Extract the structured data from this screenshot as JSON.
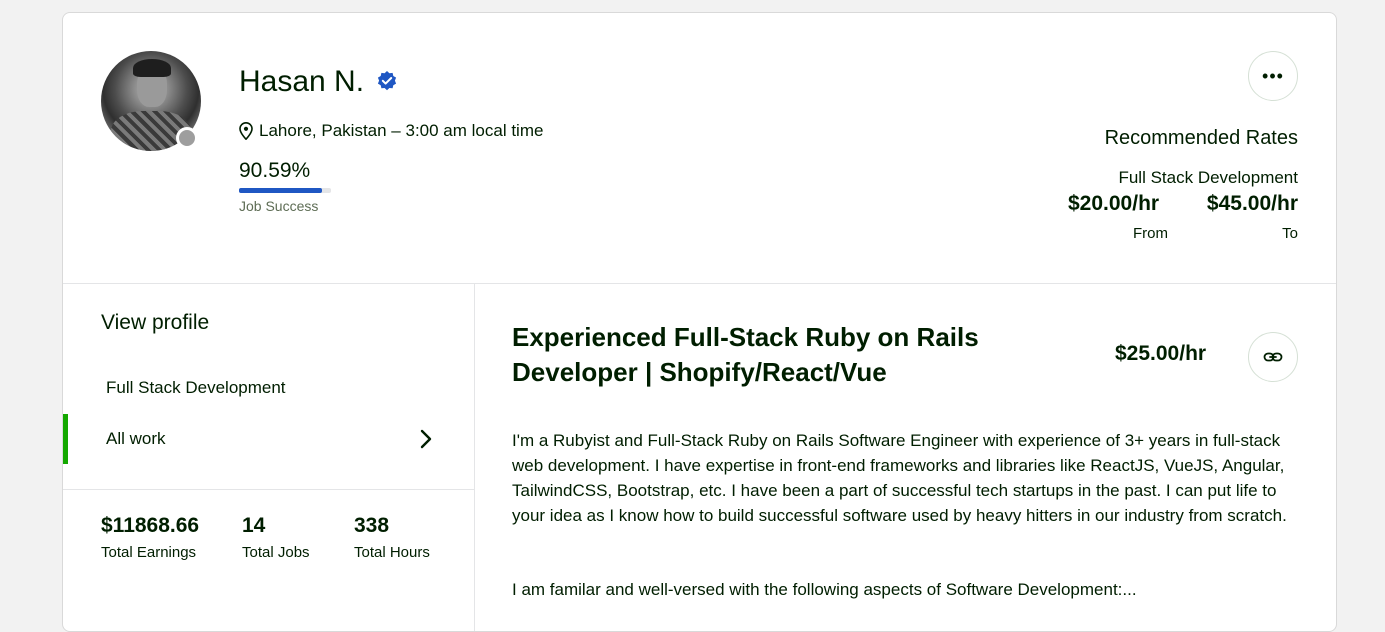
{
  "profile": {
    "name": "Hasan N.",
    "location": "Lahore, Pakistan – 3:00 am local time",
    "job_success_value": "90.59%",
    "job_success_fraction": 0.9059,
    "job_success_label": "Job Success",
    "more_button": "•••"
  },
  "rates": {
    "title": "Recommended Rates",
    "specialty": "Full Stack Development",
    "from_value": "$20.00/hr",
    "from_label": "From",
    "to_value": "$45.00/hr",
    "to_label": "To"
  },
  "sidebar": {
    "heading": "View profile",
    "items": [
      {
        "label": "Full Stack Development"
      },
      {
        "label": "All work"
      }
    ],
    "stats": [
      {
        "value": "$11868.66",
        "label": "Total Earnings"
      },
      {
        "value": "14",
        "label": "Total Jobs"
      },
      {
        "value": "338",
        "label": "Total Hours"
      }
    ]
  },
  "main": {
    "title": "Experienced Full-Stack Ruby on Rails Developer | Shopify/React/Vue",
    "hourly_rate": "$25.00/hr",
    "overview": "I'm a Rubyist and Full-Stack Ruby on Rails Software Engineer with experience of 3+ years in full-stack web development. I have expertise in front-end frameworks and libraries like ReactJS, VueJS, Angular, TailwindCSS, Bootstrap, etc. I have been a part of successful tech startups in the past. I can put life to your idea as I know how to build successful software used by heavy hitters in our industry from scratch.",
    "overview_2": "I am familar and well-versed with the following aspects of Software Development:..."
  },
  "colors": {
    "accent_green": "#14a800",
    "verified_blue": "#1f57c3",
    "text": "#001e00"
  },
  "icons": {
    "verified": "verified-badge-icon",
    "location": "location-pin-icon",
    "more": "more-horizontal-icon",
    "chevron": "chevron-right-icon",
    "link": "link-icon"
  }
}
